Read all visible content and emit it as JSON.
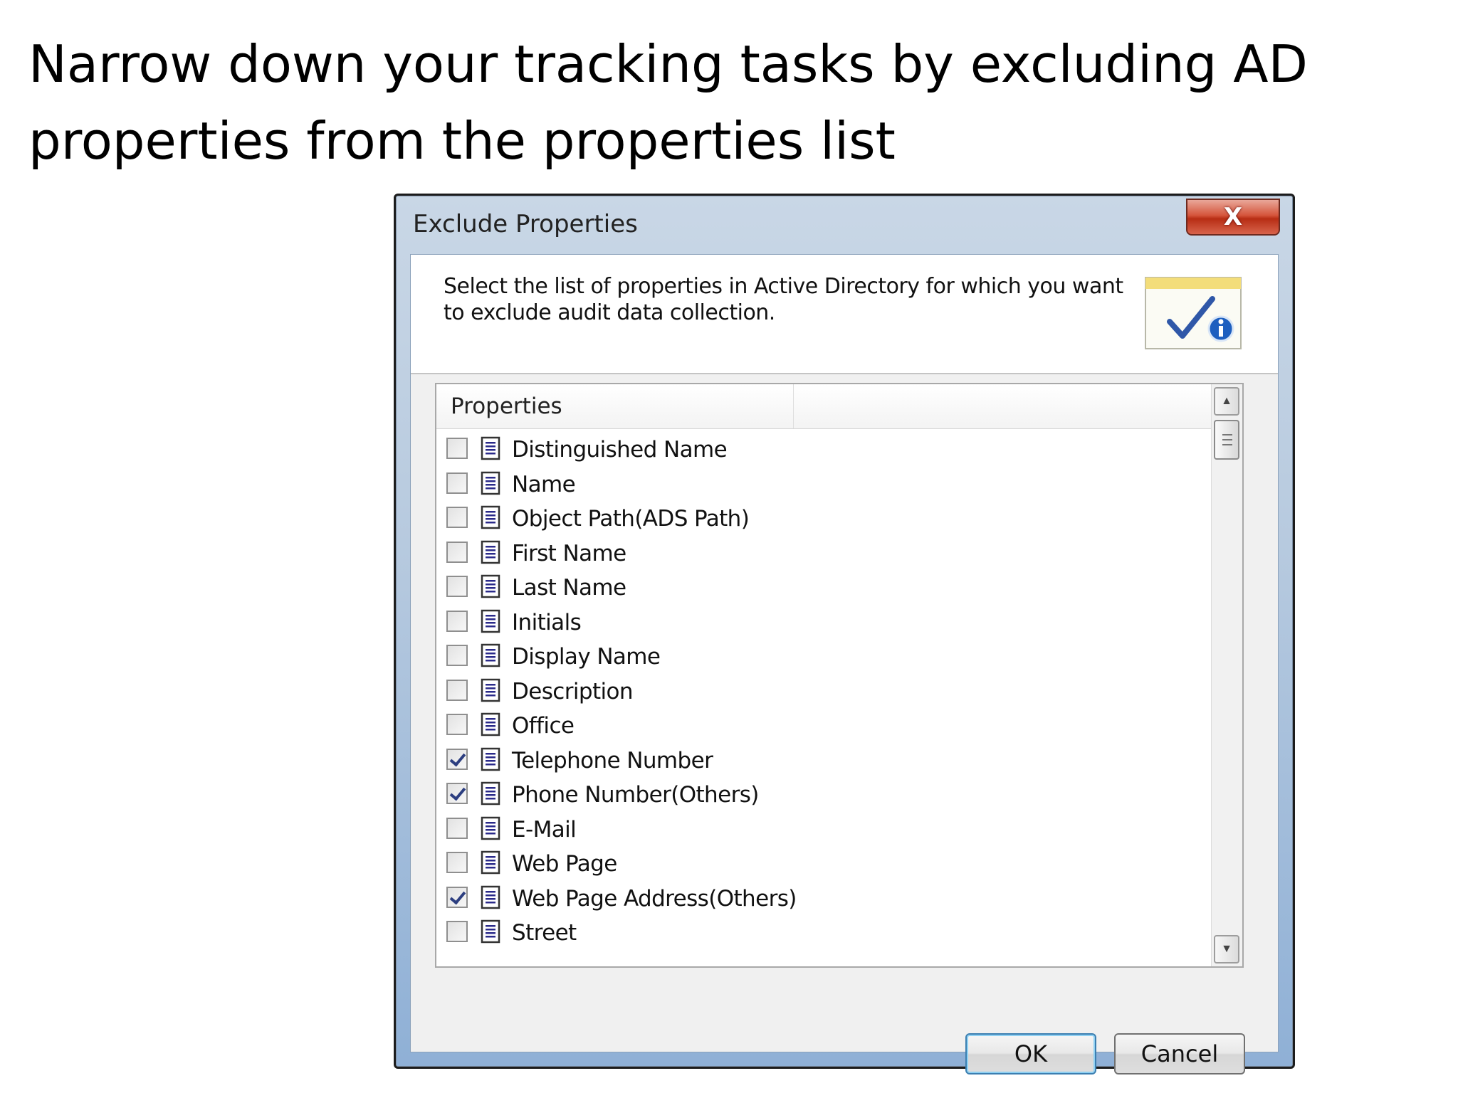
{
  "slide": {
    "title": "Narrow down your tracking tasks by excluding AD properties from the properties list"
  },
  "dialog": {
    "title": "Exclude Properties",
    "close_label": "X",
    "description": "Select the list of properties in Active Directory for which you want to exclude audit data collection.",
    "header_icon": "checklist-info-icon",
    "list": {
      "column_header": "Properties",
      "items": [
        {
          "label": "Distinguished Name",
          "checked": false
        },
        {
          "label": "Name",
          "checked": false
        },
        {
          "label": "Object Path(ADS Path)",
          "checked": false
        },
        {
          "label": "First Name",
          "checked": false
        },
        {
          "label": "Last Name",
          "checked": false
        },
        {
          "label": "Initials",
          "checked": false
        },
        {
          "label": "Display Name",
          "checked": false
        },
        {
          "label": "Description",
          "checked": false
        },
        {
          "label": "Office",
          "checked": false
        },
        {
          "label": "Telephone Number",
          "checked": true
        },
        {
          "label": "Phone Number(Others)",
          "checked": true
        },
        {
          "label": "E-Mail",
          "checked": false
        },
        {
          "label": "Web Page",
          "checked": false
        },
        {
          "label": "Web Page Address(Others)",
          "checked": true
        },
        {
          "label": "Street",
          "checked": false
        }
      ]
    },
    "ok_label": "OK",
    "cancel_label": "Cancel"
  }
}
